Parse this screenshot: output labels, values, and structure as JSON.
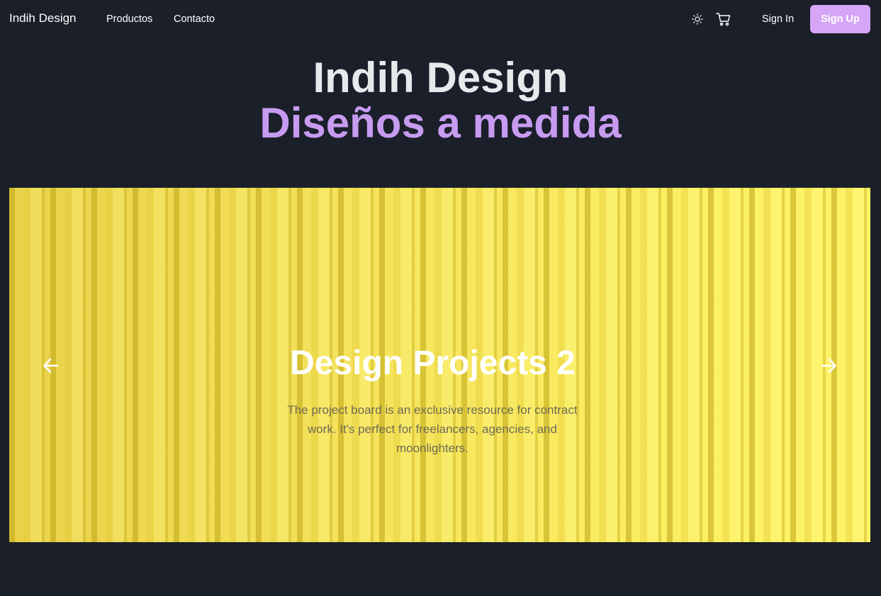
{
  "nav": {
    "brand": "Indih Design",
    "links": [
      "Productos",
      "Contacto"
    ],
    "theme_icon": "sun-icon",
    "cart_icon": "cart-icon",
    "sign_in": "Sign In",
    "sign_up": "Sign Up"
  },
  "hero": {
    "title": "Indih Design",
    "subtitle": "Diseños a medida"
  },
  "carousel": {
    "slide_title": "Design Projects 2",
    "slide_description": "The project board is an exclusive resource for contract work. It's perfect for freelancers, agencies, and moonlighters.",
    "prev_icon": "arrow-left-icon",
    "next_icon": "arrow-right-icon"
  },
  "colors": {
    "background": "#1b1f2a",
    "accent": "#d5a5f7",
    "subtitle": "#c79bf0"
  }
}
